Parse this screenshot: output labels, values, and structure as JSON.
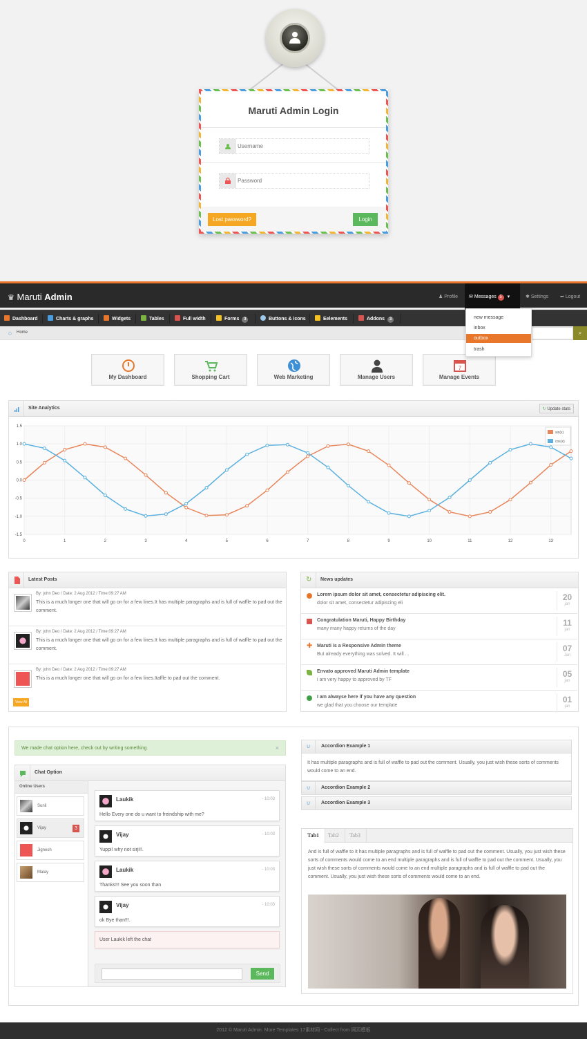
{
  "login": {
    "title": "Maruti Admin Login",
    "username_placeholder": "Username",
    "password_placeholder": "Password",
    "lost_password_label": "Lost password?",
    "login_label": "Login"
  },
  "header": {
    "brand_light": "Maruti",
    "brand_bold": "Admin",
    "profile": "Profile",
    "messages": "Messages",
    "messages_count": "5",
    "settings": "Settings",
    "logout": "Logout"
  },
  "messages_menu": [
    "new message",
    "inbox",
    "outbox",
    "trash"
  ],
  "main_nav": [
    {
      "label": "Dashboard",
      "icon": "home-icon",
      "badge": ""
    },
    {
      "label": "Charts & graphs",
      "icon": "bar-chart-icon",
      "badge": ""
    },
    {
      "label": "Widgets",
      "icon": "inbox-icon",
      "badge": ""
    },
    {
      "label": "Tables",
      "icon": "grid-icon",
      "badge": ""
    },
    {
      "label": "Full width",
      "icon": "fullscreen-icon",
      "badge": ""
    },
    {
      "label": "Forms",
      "icon": "list-icon",
      "badge": "3"
    },
    {
      "label": "Buttons & icons",
      "icon": "tint-icon",
      "badge": ""
    },
    {
      "label": "Eelements",
      "icon": "pencil-icon",
      "badge": ""
    },
    {
      "label": "Addons",
      "icon": "file-icon",
      "badge": "3"
    }
  ],
  "breadcrumb": {
    "home": "Home"
  },
  "quick_actions": [
    "My Dashboard",
    "Shopping Cart",
    "Web Marketing",
    "Manage Users",
    "Manage Events"
  ],
  "analytics": {
    "title": "Site Analytics",
    "update_label": "Update stats"
  },
  "chart_data": {
    "type": "line",
    "x": [
      0,
      0.5,
      1,
      1.5,
      2,
      2.5,
      3,
      3.5,
      4,
      4.5,
      5,
      5.5,
      6,
      6.5,
      7,
      7.5,
      8,
      8.5,
      9,
      9.5,
      10,
      10.5,
      11,
      11.5,
      12,
      12.5,
      13,
      13.5
    ],
    "series": [
      {
        "name": "sin(x)",
        "color": "#e8855a",
        "values": [
          0,
          0.48,
          0.84,
          1.0,
          0.91,
          0.6,
          0.14,
          -0.35,
          -0.76,
          -0.98,
          -0.96,
          -0.71,
          -0.28,
          0.22,
          0.66,
          0.94,
          0.99,
          0.8,
          0.41,
          -0.08,
          -0.54,
          -0.88,
          -1.0,
          -0.88,
          -0.54,
          -0.07,
          0.42,
          0.8
        ]
      },
      {
        "name": "cos(x)",
        "color": "#5ab0df",
        "values": [
          1.0,
          0.88,
          0.54,
          0.07,
          -0.42,
          -0.8,
          -0.99,
          -0.94,
          -0.65,
          -0.21,
          0.28,
          0.71,
          0.96,
          0.98,
          0.75,
          0.35,
          -0.15,
          -0.6,
          -0.91,
          -1.0,
          -0.84,
          -0.48,
          0.0,
          0.48,
          0.84,
          1.0,
          0.91,
          0.6
        ]
      }
    ],
    "xlim": [
      0,
      13.5
    ],
    "ylim": [
      -1.5,
      1.5
    ],
    "yticks": [
      "1.5",
      "1.0",
      "0.5",
      "0.0",
      "-0.5",
      "-1.0",
      "-1.5"
    ],
    "xticks": [
      "0",
      "1",
      "2",
      "3",
      "4",
      "5",
      "6",
      "7",
      "8",
      "9",
      "10",
      "11",
      "12",
      "13"
    ],
    "grid": true,
    "legend": "top-right"
  },
  "latest_posts": {
    "title": "Latest Posts",
    "items": [
      {
        "meta": "By: john Deo / Date: 2 Aug 2012 / Time:09:27 AM",
        "text": "This is a much longer one that will go on for a few lines.It has multiple paragraphs and is full of waffle to pad out the comment."
      },
      {
        "meta": "By: john Deo / Date: 2 Aug 2012 / Time:09:27 AM",
        "text": "This is a much longer one that will go on for a few lines.It has multiple paragraphs and is full of waffle to pad out the comment."
      },
      {
        "meta": "By: john Deo / Date: 2 Aug 2012 / Time:09:27 AM",
        "text": "This is a much longer one that will go on for a few lines.Itaffle to pad out the comment."
      }
    ],
    "view_all": "View All"
  },
  "news": {
    "title": "News updates",
    "items": [
      {
        "title": "Lorem ipsum dolor sit amet, consectetur adipiscing elit.",
        "sub": "dolor sit amet, consectetur adipiscing eli",
        "day": "20",
        "month": "jan",
        "color": "#e8772b"
      },
      {
        "title": "Congratulation Maruti, Happy Birthday",
        "sub": "many many happy returns of the day",
        "day": "11",
        "month": "jan",
        "color": "#d9534f"
      },
      {
        "title": "Maruti is a Responsive Admin theme",
        "sub": "But already everything was solved. It will ...",
        "day": "07",
        "month": "Jan",
        "color": "#e8772b"
      },
      {
        "title": "Envato approved Maruti Admin template",
        "sub": "i am very happy to approved by TF",
        "day": "05",
        "month": "jan",
        "color": "#7cb342"
      },
      {
        "title": "I am alwayse here if you have any question",
        "sub": "we glad that you choose our template",
        "day": "01",
        "month": "jan",
        "color": "#43a047"
      }
    ]
  },
  "alert": {
    "text": "We made chat option here, check out by writing something",
    "close": "×"
  },
  "chat": {
    "title": "Chat Option",
    "online_label": "Online Users",
    "users": [
      {
        "name": "Sunil",
        "badge": ""
      },
      {
        "name": "Vijay",
        "badge": "3"
      },
      {
        "name": "Jignesh",
        "badge": ""
      },
      {
        "name": "Malay",
        "badge": ""
      }
    ],
    "messages": [
      {
        "name": "Laukik",
        "time": "- 10:03",
        "text": "Hello Every one do u want to freindship with me?"
      },
      {
        "name": "Vijay",
        "time": "- 10:03",
        "text": "Yuppi! why not sirji!!."
      },
      {
        "name": "Laukik",
        "time": "- 10:03",
        "text": "Thanks!!! See you soon than"
      },
      {
        "name": "Vijay",
        "time": "- 10:03",
        "text": "ok Bye than!!!."
      }
    ],
    "left_notice": "User Laukik left the chat",
    "send_label": "Send"
  },
  "accordion": {
    "items": [
      {
        "title": "Accordion Example 1",
        "body": "It has multiple paragraphs and is full of waffle to pad out the comment. Usually, you just wish these sorts of comments would come to an end."
      },
      {
        "title": "Accordion Example 2"
      },
      {
        "title": "Accordion Example 3"
      }
    ]
  },
  "tabs": {
    "labels": [
      "Tab1",
      "Tab2",
      "Tab3"
    ],
    "body": "And is full of waffle to It has multiple paragraphs and is full of waffle to pad out the comment. Usually, you just wish these sorts of comments would come to an end multiple paragraphs and is full of waffle to pad out the comment. Usually, you just wish these sorts of comments would come to an end multiple paragraphs and is full of waffle to pad out the comment. Usually, you just wish these sorts of comments would come to an end."
  },
  "footer": {
    "text": "2012 © Maruti Admin. More Templates 17素材网 - Collect from 网页模板"
  }
}
